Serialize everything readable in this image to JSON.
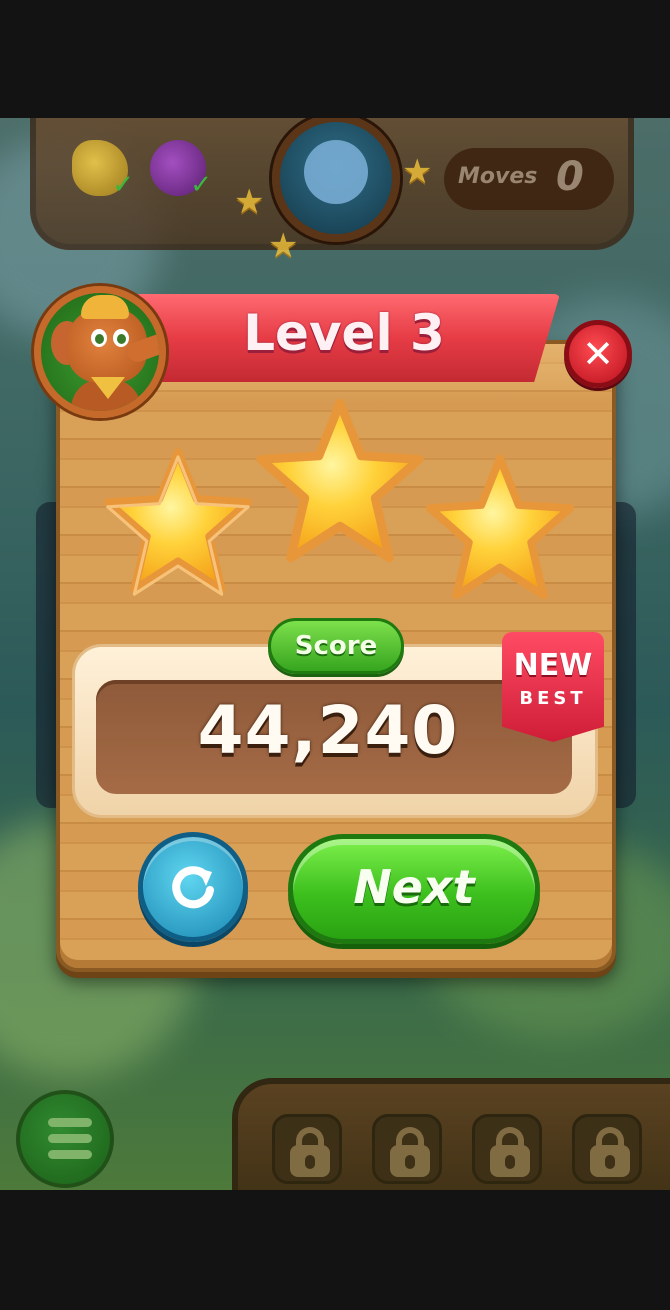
{
  "hud": {
    "moves_label": "Moves",
    "moves_value": "0",
    "goals": [
      {
        "icon": "banana-icon",
        "completed": true
      },
      {
        "icon": "blackberry-icon",
        "completed": true
      }
    ]
  },
  "popup": {
    "title": "Level 3",
    "stars_earned": 3,
    "stars_total": 3,
    "score_label": "Score",
    "score_value": "44,240",
    "badge_line1": "NEW",
    "badge_line2": "BEST",
    "next_label": "Next",
    "close_symbol": "✕"
  },
  "bottom_bar": {
    "locked_slots": 4
  },
  "colors": {
    "ribbon": "#e63c46",
    "next_button": "#3dc01e",
    "replay_button": "#1a86b2",
    "star": "#ffd23a"
  }
}
